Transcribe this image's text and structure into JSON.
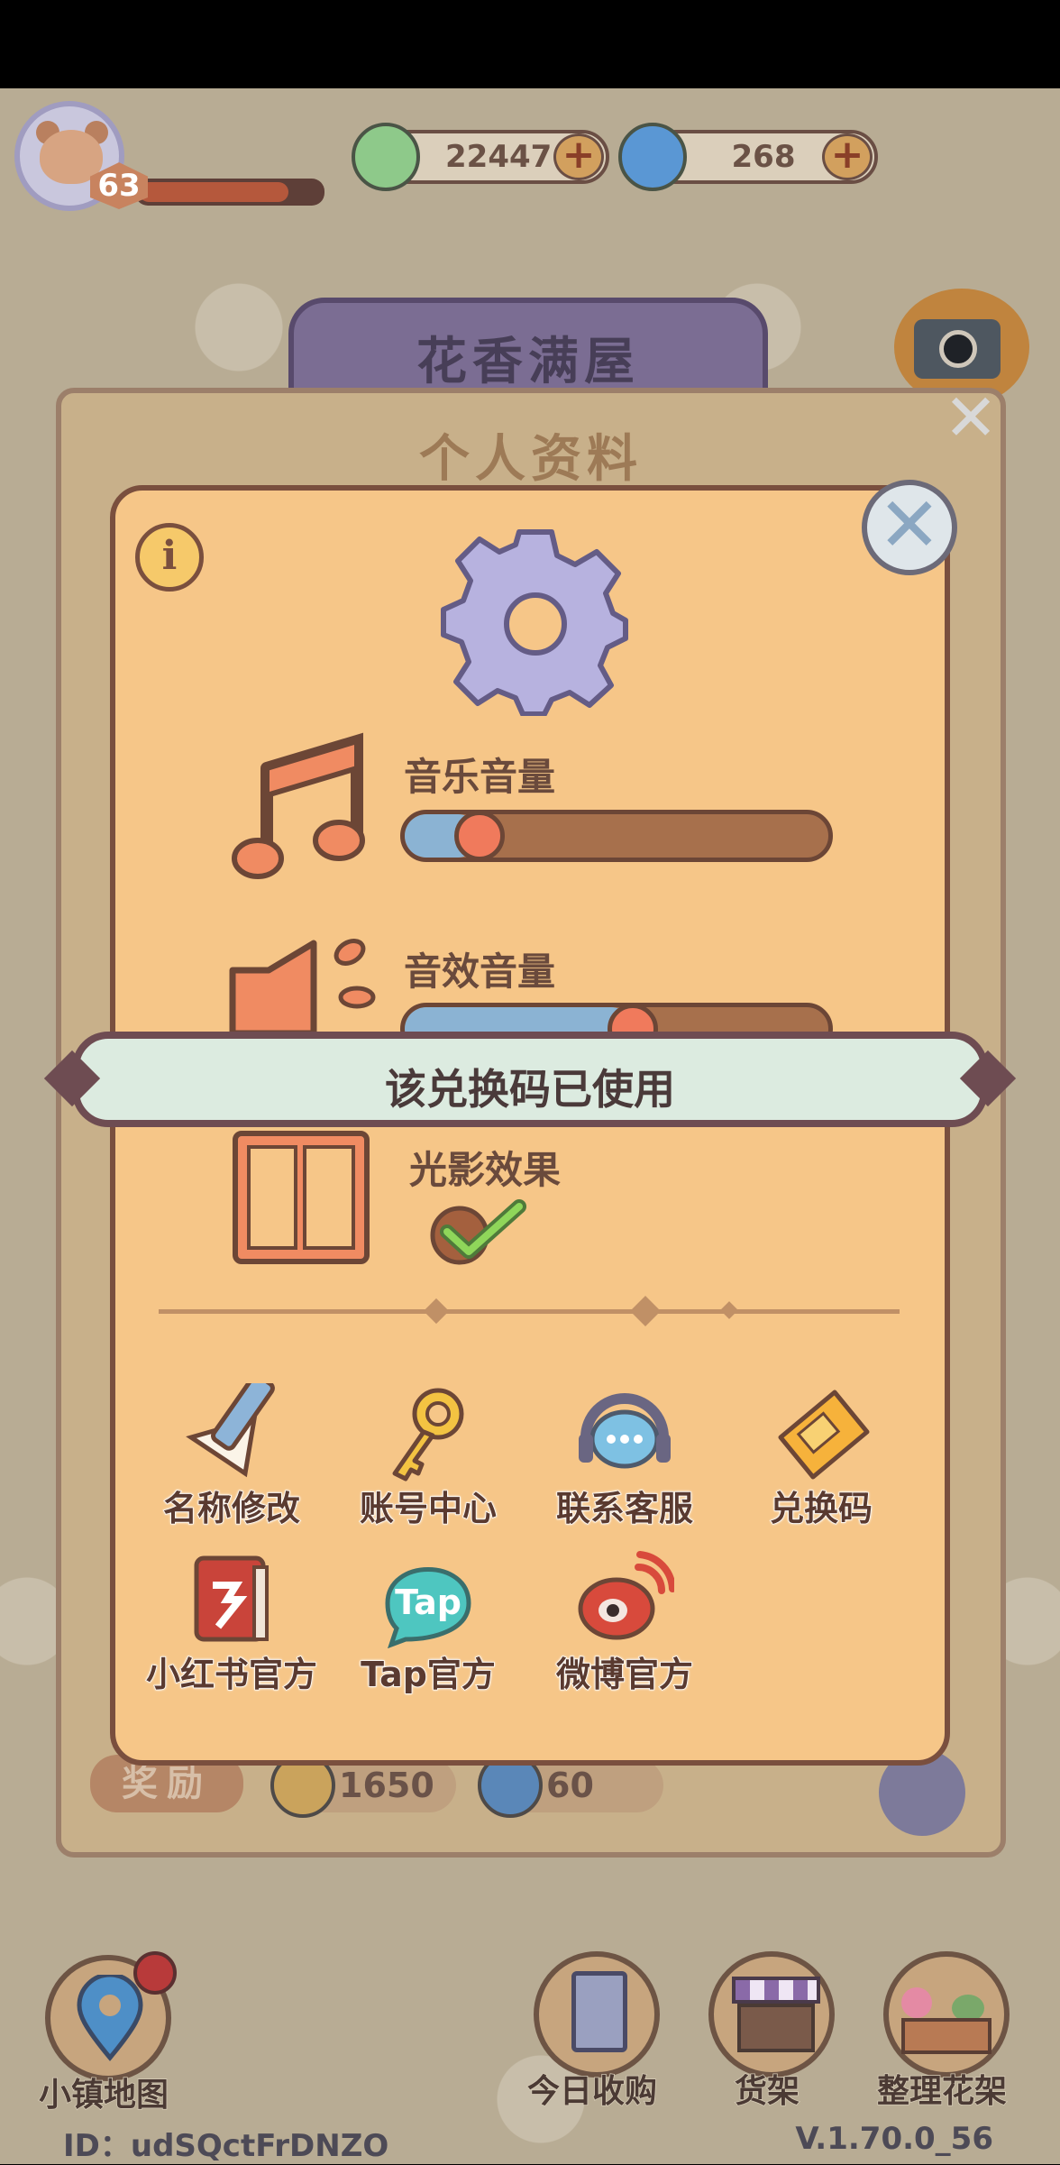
{
  "hud": {
    "level": "63",
    "xp_progress": 0.82,
    "leaf_currency": "22447",
    "swirl_currency": "268",
    "plus_symbol": "+",
    "shop_title": "花香满屋"
  },
  "back_panel": {
    "title": "个人资料",
    "reward_label": "奖励",
    "reward_coins": "1650",
    "reward_swirls": "60"
  },
  "settings": {
    "info_symbol": "i",
    "close_symbol": "✕",
    "music_volume_label": "音乐音量",
    "music_volume": 0.18,
    "sfx_volume_label": "音效音量",
    "sfx_volume": 0.55,
    "light_effect_label": "光影效果",
    "light_effect_on": true,
    "toast": "该兑换码已使用",
    "buttons": [
      {
        "label": "名称修改",
        "icon": "pencil-paper-icon"
      },
      {
        "label": "账号中心",
        "icon": "key-icon"
      },
      {
        "label": "联系客服",
        "icon": "headset-chat-icon"
      },
      {
        "label": "兑换码",
        "icon": "ticket-icon"
      },
      {
        "label": "小红书官方",
        "icon": "red-book-icon"
      },
      {
        "label": "Tap官方",
        "icon": "tap-logo-icon"
      },
      {
        "label": "微博官方",
        "icon": "weibo-icon"
      }
    ],
    "tap_logo_text": "Tap"
  },
  "bottom_nav": [
    {
      "label": "小镇地图",
      "icon": "map-pin-icon"
    },
    {
      "label": "今日收购",
      "icon": "sign-board-icon"
    },
    {
      "label": "货架",
      "icon": "market-stall-icon"
    },
    {
      "label": "整理花架",
      "icon": "flower-pots-icon"
    }
  ],
  "footer": {
    "id_text": "ID：udSQctFrDNZO",
    "version": "V.1.70.0_56"
  },
  "colors": {
    "panel": "#f6c688",
    "panel_border": "#7a4f3e",
    "slider_fill": "#8bb3d3",
    "knob": "#f07a5c",
    "toast_bg": "#dcebe0"
  }
}
